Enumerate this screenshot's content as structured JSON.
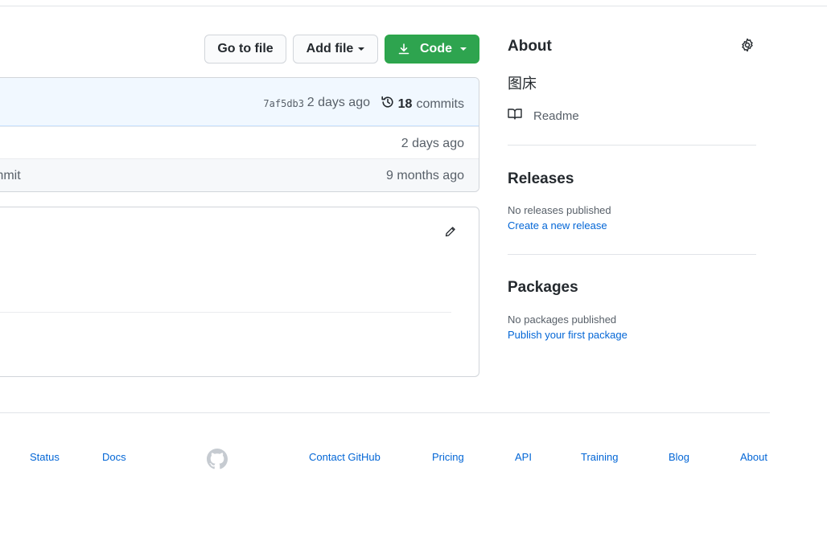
{
  "actions": {
    "goto_file": "Go to file",
    "add_file": "Add file",
    "code": "Code"
  },
  "commit": {
    "sha": "7af5db3",
    "age": "2 days ago",
    "commit_count": "18",
    "commits_label": "commits"
  },
  "files": [
    {
      "message": "",
      "age": "2 days ago"
    },
    {
      "message": "mmit",
      "age": "9 months ago"
    }
  ],
  "about": {
    "title": "About",
    "description": "图床",
    "readme": "Readme"
  },
  "releases": {
    "title": "Releases",
    "empty": "No releases published",
    "link": "Create a new release"
  },
  "packages": {
    "title": "Packages",
    "empty": "No packages published",
    "link": "Publish your first package"
  },
  "footer": {
    "links": [
      "Status",
      "Docs",
      "Contact GitHub",
      "Pricing",
      "API",
      "Training",
      "Blog",
      "About"
    ]
  },
  "colors": {
    "primary_green": "#2ea44f",
    "link_blue": "#0366d6",
    "commit_bar_bg": "#f1f8ff"
  },
  "icons": [
    "download-icon",
    "history-icon",
    "pencil-icon",
    "gear-icon",
    "book-icon",
    "github-mark-icon"
  ]
}
